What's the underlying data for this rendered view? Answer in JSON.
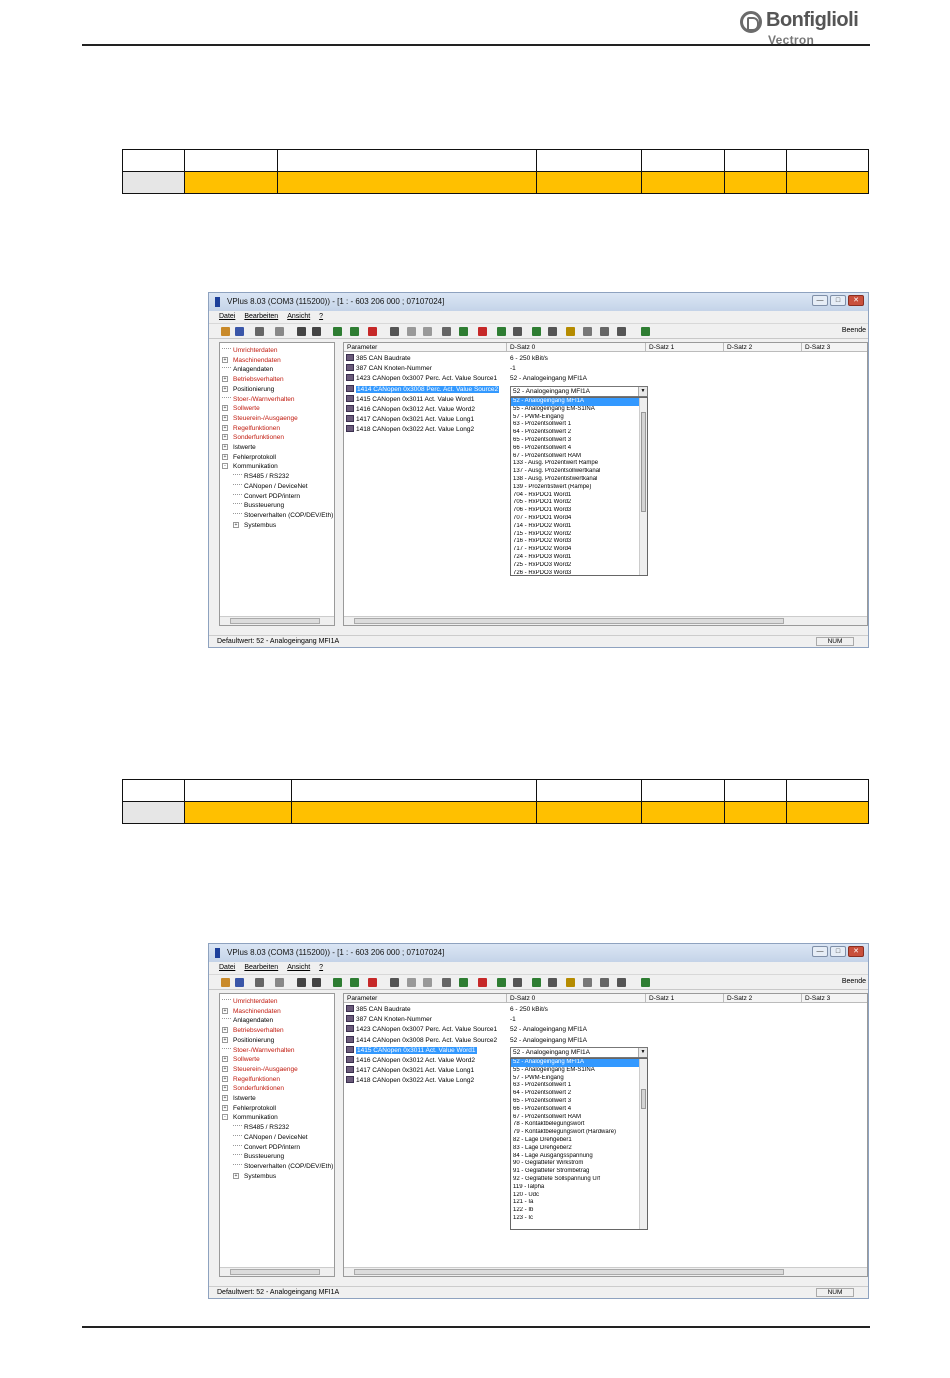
{
  "brand": {
    "name": "Bonfiglioli",
    "sub": "Vectron"
  },
  "window": {
    "title": "VPlus 8.03 (COM3 (115200)) - [1 : -   603 206 000 ; 07107024]",
    "menu": [
      "Datei",
      "Bearbeiten",
      "Ansicht",
      "?"
    ],
    "toolbar_close": "Beende",
    "tree": [
      {
        "label": "Umrichterdaten",
        "red": true,
        "exp": ""
      },
      {
        "label": "Maschinendaten",
        "red": true,
        "exp": "+"
      },
      {
        "label": "Anlagendaten",
        "red": false,
        "exp": ""
      },
      {
        "label": "Betriebsverhalten",
        "red": true,
        "exp": "+"
      },
      {
        "label": "Positionierung",
        "red": false,
        "exp": "+"
      },
      {
        "label": "Stoer-/Warnverhalten",
        "red": true,
        "exp": ""
      },
      {
        "label": "Sollwerte",
        "red": true,
        "exp": "+"
      },
      {
        "label": "Steuerein-/Ausgaenge",
        "red": true,
        "exp": "+"
      },
      {
        "label": "Regelfunktionen",
        "red": true,
        "exp": "+"
      },
      {
        "label": "Sonderfunktionen",
        "red": true,
        "exp": "+"
      },
      {
        "label": "Istwerte",
        "red": false,
        "exp": "+"
      },
      {
        "label": "Fehlerprotokoll",
        "red": false,
        "exp": "+"
      },
      {
        "label": "Kommunikation",
        "red": false,
        "exp": "-"
      },
      {
        "label": "RS485 / RS232",
        "red": false,
        "exp": "",
        "child": true
      },
      {
        "label": "CANopen / DeviceNet",
        "red": false,
        "exp": "",
        "child": true
      },
      {
        "label": "Convert PDP/intern",
        "red": false,
        "exp": "",
        "child": true
      },
      {
        "label": "Bussteuerung",
        "red": false,
        "exp": "",
        "child": true
      },
      {
        "label": "Stoerverhalten (COP/DEV/Eth)",
        "red": false,
        "exp": "",
        "child": true
      },
      {
        "label": "Systembus",
        "red": false,
        "exp": "+",
        "child": true
      }
    ],
    "columns": [
      "Parameter",
      "D-Satz 0",
      "D-Satz 1",
      "D-Satz 2",
      "D-Satz 3"
    ],
    "status_text": "Defaultwert: 52 - Analogeingang MFI1A",
    "status_num": "NUM"
  },
  "screen1": {
    "params": [
      {
        "label": "385 CAN Baudrate",
        "value": "6 - 250 kBit/s"
      },
      {
        "label": "387 CAN Knoten-Nummer",
        "value": "-1"
      },
      {
        "label": "1423 CANopen 0x3007 Perc. Act. Value Source1",
        "value": "52 - Analogeingang MFI1A"
      },
      {
        "label": "1414 CANopen 0x3008 Perc. Act. Value Source2",
        "value": "",
        "selected": true
      },
      {
        "label": "1415 CANopen 0x3011 Act. Value Word1",
        "value": ""
      },
      {
        "label": "1416 CANopen 0x3012 Act. Value Word2",
        "value": ""
      },
      {
        "label": "1417 CANopen 0x3021 Act. Value Long1",
        "value": ""
      },
      {
        "label": "1418 CANopen 0x3022 Act. Value Long2",
        "value": ""
      }
    ],
    "combo": "52 - Analogeingang MFI1A",
    "options": [
      "52 - Analogeingang MFI1A",
      "55 - Analogeingang EM-S1INA",
      "57 - PWM-Eingang",
      "63 - Prozentsollwert 1",
      "64 - Prozentsollwert 2",
      "65 - Prozentsollwert 3",
      "66 - Prozentsollwert 4",
      "67 - Prozentsollwert RAM",
      "133 - Ausg. Prozentwert Rampe",
      "137 - Ausg. Prozentsollwertkanal",
      "138 - Ausg. Prozentistwertkanal",
      "139 - Prozentistwert (Rampe)",
      "704 - RxPDO1 Word1",
      "705 - RxPDO1 Word2",
      "706 - RxPDO1 Word3",
      "707 - RxPDO1 Word4",
      "714 - RxPDO2 Word1",
      "715 - RxPDO2 Word2",
      "716 - RxPDO2 Word3",
      "717 - RxPDO2 Word4",
      "724 - RxPDO3 Word1",
      "725 - RxPDO3 Word2",
      "726 - RxPDO3 Word3"
    ]
  },
  "screen2": {
    "params": [
      {
        "label": "385 CAN Baudrate",
        "value": "6 - 250 kBit/s"
      },
      {
        "label": "387 CAN Knoten-Nummer",
        "value": "-1"
      },
      {
        "label": "1423 CANopen 0x3007 Perc. Act. Value Source1",
        "value": "52 - Analogeingang MFI1A"
      },
      {
        "label": "1414 CANopen 0x3008 Perc. Act. Value Source2",
        "value": "52 - Analogeingang MFI1A"
      },
      {
        "label": "1415 CANopen 0x3011 Act. Value Word1",
        "value": "",
        "selected": true
      },
      {
        "label": "1416 CANopen 0x3012 Act. Value Word2",
        "value": ""
      },
      {
        "label": "1417 CANopen 0x3021 Act. Value Long1",
        "value": ""
      },
      {
        "label": "1418 CANopen 0x3022 Act. Value Long2",
        "value": ""
      }
    ],
    "combo": "52 - Analogeingang MFI1A",
    "options": [
      "52 - Analogeingang MFI1A",
      "55 - Analogeingang EM-S1INA",
      "57 - PWM-Eingang",
      "63 - Prozentsollwert 1",
      "64 - Prozentsollwert 2",
      "65 - Prozentsollwert 3",
      "66 - Prozentsollwert 4",
      "67 - Prozentsollwert RAM",
      "78 - Kontaktbelegungswort",
      "79 - Kontaktbelegungswort (Hardware)",
      "82 - Lage Drehgeber1",
      "83 - Lage Drehgeber2",
      "84 - Lage Ausgangsspannung",
      "90 - Geglätteter Wirkstrom",
      "91 - Geglätteter Strombetrag",
      "92 - Geglättete Sollspannung U/f",
      "119 - Ialpha",
      "120 - Udc",
      "121 - Ia",
      "122 - Ib",
      "123 - Ic"
    ]
  },
  "colors": {
    "table_fill": "#ffc000",
    "selection": "#3399ff",
    "tree_red": "#c0180c"
  }
}
